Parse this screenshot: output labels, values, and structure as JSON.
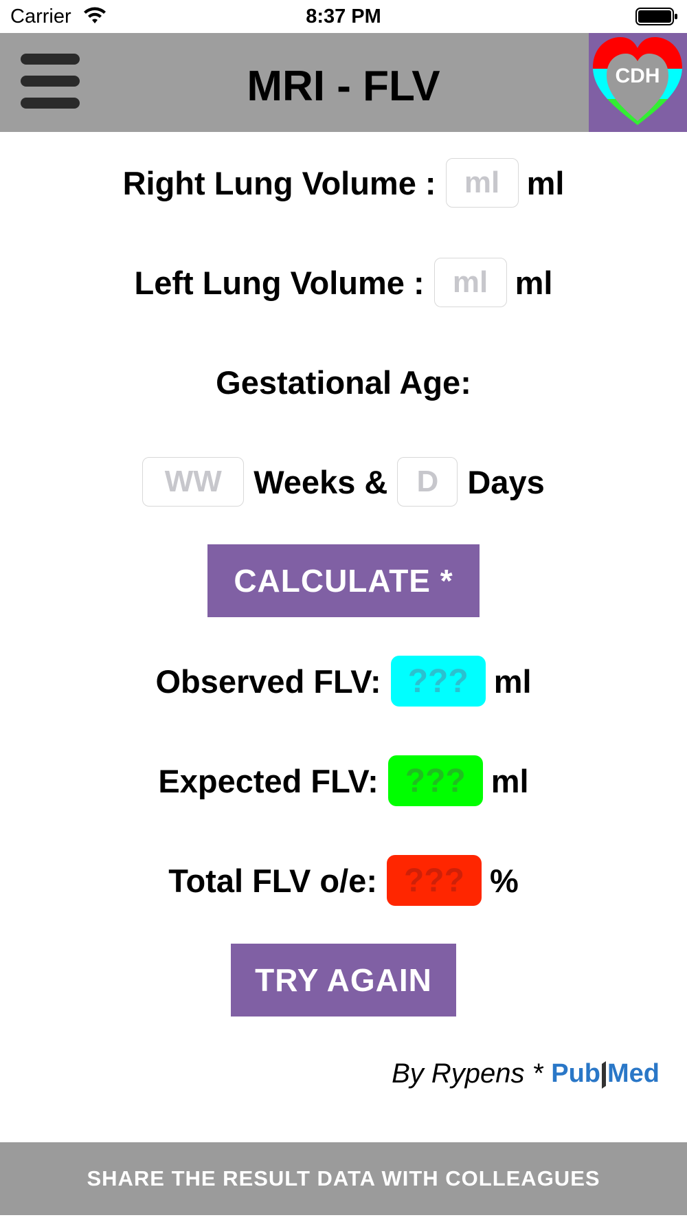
{
  "status_bar": {
    "carrier": "Carrier",
    "time": "8:37 PM",
    "wifi_icon": "wifi-icon",
    "battery_icon": "battery-full-icon"
  },
  "nav": {
    "title": "MRI - FLV",
    "menu_icon": "hamburger-menu-icon",
    "logo_text": "CDH"
  },
  "form": {
    "right_lung_label": "Right Lung Volume :",
    "right_lung_placeholder": "ml",
    "right_lung_unit": "ml",
    "left_lung_label": "Left Lung Volume :",
    "left_lung_placeholder": "ml",
    "left_lung_unit": "ml",
    "gestational_age_label": "Gestational Age:",
    "weeks_placeholder": "WW",
    "weeks_label": "Weeks &",
    "days_placeholder": "D",
    "days_label": "Days"
  },
  "buttons": {
    "calculate": "CALCULATE *",
    "try_again": "TRY AGAIN"
  },
  "results": {
    "observed_label": "Observed FLV:",
    "observed_value": "???",
    "observed_unit": "ml",
    "expected_label": "Expected FLV:",
    "expected_value": "???",
    "expected_unit": "ml",
    "total_label": "Total FLV o/e:",
    "total_value": "???",
    "total_unit": "%"
  },
  "credit": {
    "by_text": "By Rypens *",
    "pubmed_pub": "Pub",
    "pubmed_med": "Med"
  },
  "footer": {
    "share_label": "SHARE THE RESULT DATA WITH COLLEAGUES"
  },
  "colors": {
    "nav_bg": "#9e9e9e",
    "button_purple": "#8060a4",
    "observed_bg": "#00ffff",
    "observed_text": "#2bc1d0",
    "expected_bg": "#00ff00",
    "expected_text": "#1fbf1f",
    "total_bg": "#ff2600",
    "total_text": "#cf2008",
    "pubmed_blue": "#2a77c7"
  }
}
